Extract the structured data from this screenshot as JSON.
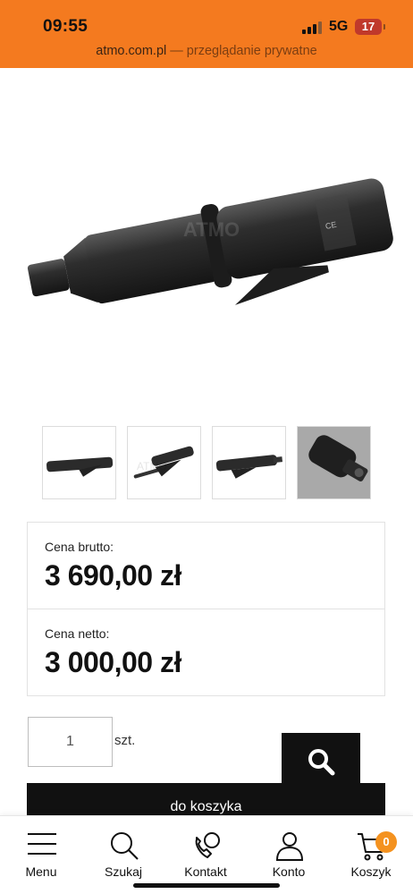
{
  "status_bar": {
    "time": "09:55",
    "network": "5G",
    "battery": "17"
  },
  "address_bar": {
    "domain": "atmo.com.pl",
    "suffix": " — przeglądanie prywatne"
  },
  "product": {
    "image_watermark": "ATMO",
    "thumbnail_count": 4,
    "price_gross": {
      "label": "Cena brutto:",
      "value": "3 690,00 zł"
    },
    "price_net": {
      "label": "Cena netto:",
      "value": "3 000,00 zł"
    }
  },
  "purchase": {
    "quantity": "1",
    "unit": "szt.",
    "add_to_cart_label": "do koszyka"
  },
  "bottom_nav": {
    "items": [
      {
        "label": "Menu",
        "icon": "menu-icon"
      },
      {
        "label": "Szukaj",
        "icon": "search-icon"
      },
      {
        "label": "Kontakt",
        "icon": "phone-chat-icon"
      },
      {
        "label": "Konto",
        "icon": "user-icon"
      },
      {
        "label": "Koszyk",
        "icon": "cart-icon"
      }
    ],
    "cart_count": "0"
  },
  "colors": {
    "accent": "#f47a1f",
    "badge": "#f4921f",
    "battery": "#c0392b",
    "button": "#111111"
  }
}
